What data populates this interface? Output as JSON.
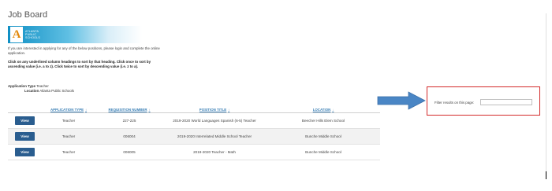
{
  "page": {
    "title": "Job Board"
  },
  "logo": {
    "lines": [
      "ATLANTA",
      "PUBLIC",
      "SCHOOLS"
    ],
    "colors": {
      "bar": "#0f8fc4",
      "mark": "#e28a0c"
    }
  },
  "intro": {
    "text": "If you are interested in applying for any of the below positions, please login and complete the online application."
  },
  "instructions": {
    "text": "Click on any underlined column headings to sort by that heading. Click once to sort by ascending value (i.e. a to z). Click twice to sort by descending value (i.e. z to a)."
  },
  "filters": {
    "application_type_label": "Application Type",
    "application_type_value": "Teacher",
    "location_label": "Location",
    "location_value": "Atlanta Public Schools"
  },
  "table": {
    "columns": [
      "APPLICATION TYPE",
      "REQUISITION NUMBER",
      "POSITION TITLE",
      "LOCATION"
    ],
    "sort_indicators": [
      "↕",
      "↕",
      "↕",
      "↓"
    ],
    "view_label": "View",
    "rows": [
      {
        "type": "Teacher",
        "req": "227-225",
        "title": "2019-2020 World Languages Spanish (6-5) Teacher",
        "location": "Beecher Hills Elem School"
      },
      {
        "type": "Teacher",
        "req": "006004",
        "title": "2019-2020 Interrelated Middle School Teacher",
        "location": "Bunche Middle School"
      },
      {
        "type": "Teacher",
        "req": "006005",
        "title": "2019-2020 Teacher - Math",
        "location": "Bunche Middle School"
      }
    ]
  },
  "filter": {
    "label": "Filter results on this page:",
    "value": "",
    "placeholder": ""
  },
  "colors": {
    "button": "#2a5d8f",
    "highlight_box": "#d32a2a",
    "arrow": "#4a86c5",
    "header_link": "#3a7fb5"
  }
}
